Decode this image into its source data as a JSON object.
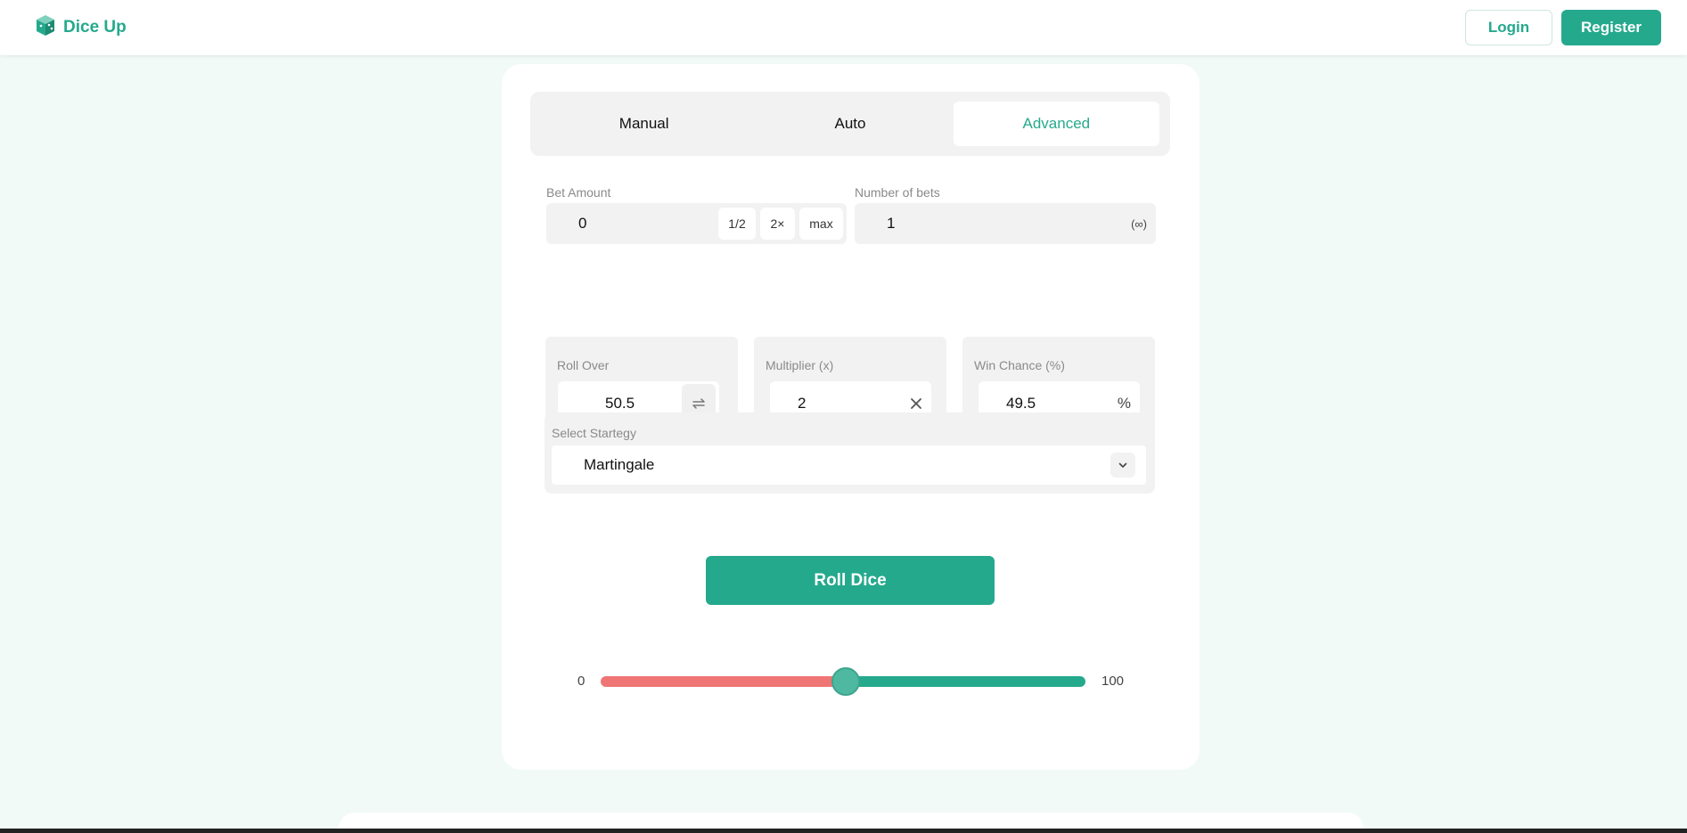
{
  "header": {
    "brand": "Dice Up",
    "login_label": "Login",
    "register_label": "Register"
  },
  "tabs": [
    {
      "label": "Manual",
      "active": false
    },
    {
      "label": "Auto",
      "active": false
    },
    {
      "label": "Advanced",
      "active": true
    }
  ],
  "bet_amount": {
    "label": "Bet Amount",
    "value": "0",
    "half_label": "1/2",
    "double_label": "2×",
    "max_label": "max"
  },
  "number_of_bets": {
    "label": "Number of bets",
    "value": "1",
    "suffix": "(∞)"
  },
  "roll_over": {
    "label": "Roll Over",
    "value": "50.5"
  },
  "multiplier": {
    "label": "Multiplier (x)",
    "value": "2"
  },
  "win_chance": {
    "label": "Win Chance (%)",
    "value": "49.5",
    "suffix": "%"
  },
  "strategy": {
    "label": "Select Startegy",
    "selected": "Martingale"
  },
  "roll_button_label": "Roll Dice",
  "slider": {
    "min_label": "0",
    "max_label": "100",
    "value": 50.5
  },
  "colors": {
    "accent": "#25a98d",
    "lose": "#f07575",
    "background": "#f1faf7"
  }
}
